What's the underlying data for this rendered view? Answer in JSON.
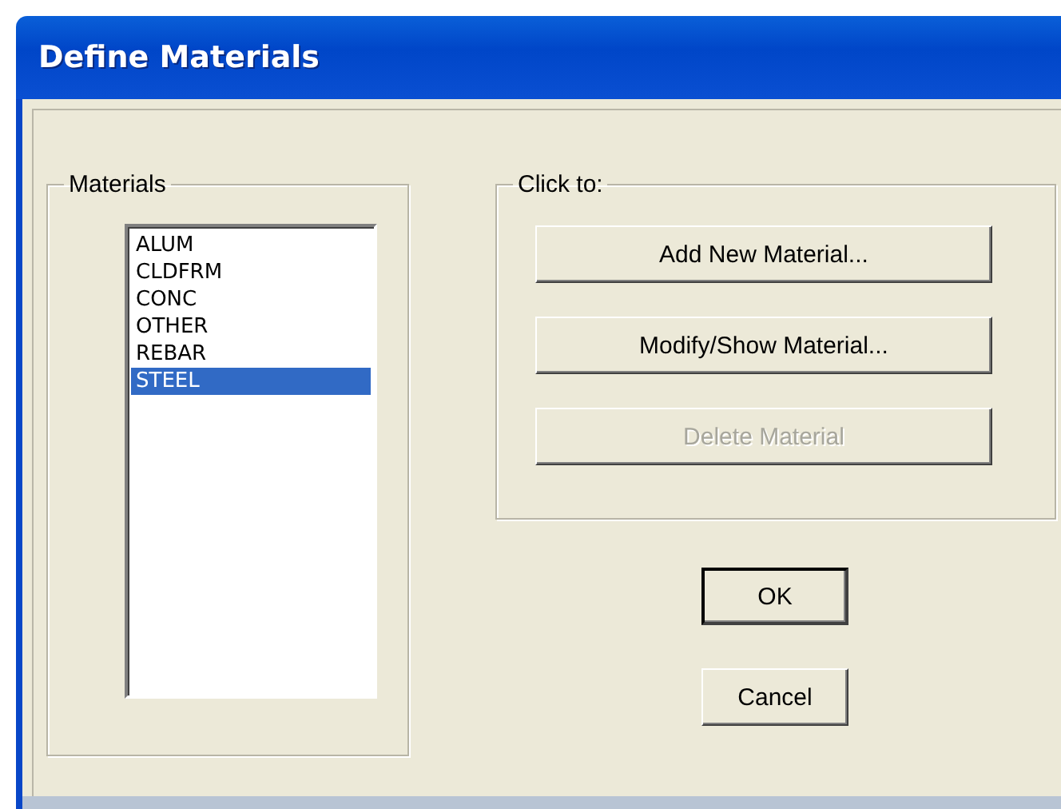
{
  "window": {
    "title": "Define Materials"
  },
  "materials": {
    "label": "Materials",
    "items": [
      {
        "name": "ALUM",
        "selected": false
      },
      {
        "name": "CLDFRM",
        "selected": false
      },
      {
        "name": "CONC",
        "selected": false
      },
      {
        "name": "OTHER",
        "selected": false
      },
      {
        "name": "REBAR",
        "selected": false
      },
      {
        "name": "STEEL",
        "selected": true
      }
    ]
  },
  "actions": {
    "label": "Click to:",
    "buttons": [
      {
        "label": "Add New Material...",
        "disabled": false
      },
      {
        "label": "Modify/Show Material...",
        "disabled": false
      },
      {
        "label": "Delete Material",
        "disabled": true
      }
    ]
  },
  "buttons": [
    {
      "label": "OK",
      "default": true
    },
    {
      "label": "Cancel",
      "default": false
    }
  ]
}
